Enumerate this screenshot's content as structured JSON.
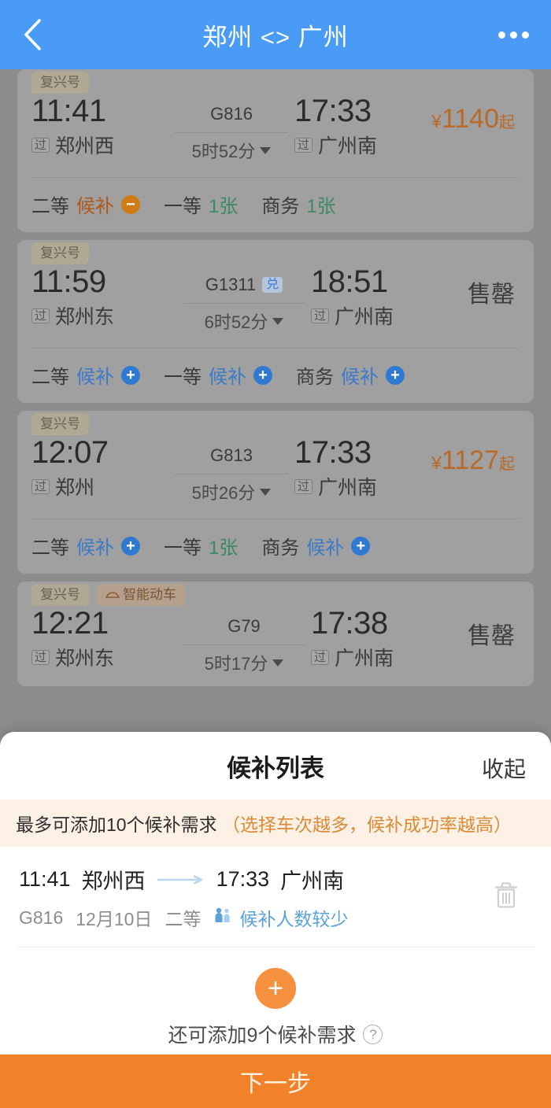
{
  "header": {
    "back_icon": "chevron-left-icon",
    "title": "郑州 <> 广州",
    "more_icon": "more-dots-icon",
    "bg_color": "#4a9bf5"
  },
  "trains": [
    {
      "badges": [
        "复兴号"
      ],
      "depart_time": "11:41",
      "depart_pass": "过",
      "depart_station": "郑州西",
      "train_no": "G816",
      "train_badge": "",
      "duration": "5时52分",
      "arrive_time": "17:33",
      "arrive_pass": "过",
      "arrive_station": "广州南",
      "price_prefix": "¥",
      "price": "1140",
      "price_suffix": "起",
      "sold_out": "",
      "seats": [
        {
          "label": "二等",
          "value": "候补",
          "state": "orange",
          "icon": "minus-circle-icon"
        },
        {
          "label": "一等",
          "value": "1张",
          "state": "green",
          "icon": ""
        },
        {
          "label": "商务",
          "value": "1张",
          "state": "green",
          "icon": ""
        }
      ]
    },
    {
      "badges": [
        "复兴号"
      ],
      "depart_time": "11:59",
      "depart_pass": "过",
      "depart_station": "郑州东",
      "train_no": "G1311",
      "train_badge": "兑",
      "duration": "6时52分",
      "arrive_time": "18:51",
      "arrive_pass": "过",
      "arrive_station": "广州南",
      "price_prefix": "",
      "price": "",
      "price_suffix": "",
      "sold_out": "售罄",
      "seats": [
        {
          "label": "二等",
          "value": "候补",
          "state": "blue",
          "icon": "plus-circle-icon"
        },
        {
          "label": "一等",
          "value": "候补",
          "state": "blue",
          "icon": "plus-circle-icon"
        },
        {
          "label": "商务",
          "value": "候补",
          "state": "blue",
          "icon": "plus-circle-icon"
        }
      ]
    },
    {
      "badges": [
        "复兴号"
      ],
      "depart_time": "12:07",
      "depart_pass": "过",
      "depart_station": "郑州",
      "train_no": "G813",
      "train_badge": "",
      "duration": "5时26分",
      "arrive_time": "17:33",
      "arrive_pass": "过",
      "arrive_station": "广州南",
      "price_prefix": "¥",
      "price": "1127",
      "price_suffix": "起",
      "sold_out": "",
      "seats": [
        {
          "label": "二等",
          "value": "候补",
          "state": "blue",
          "icon": "plus-circle-icon"
        },
        {
          "label": "一等",
          "value": "1张",
          "state": "green",
          "icon": ""
        },
        {
          "label": "商务",
          "value": "候补",
          "state": "blue",
          "icon": "plus-circle-icon"
        }
      ]
    },
    {
      "badges": [
        "复兴号",
        "智能动车"
      ],
      "depart_time": "12:21",
      "depart_pass": "过",
      "depart_station": "郑州东",
      "train_no": "G79",
      "train_badge": "",
      "duration": "5时17分",
      "arrive_time": "17:38",
      "arrive_pass": "过",
      "arrive_station": "广州南",
      "price_prefix": "",
      "price": "",
      "price_suffix": "",
      "sold_out": "售罄",
      "seats": []
    }
  ],
  "sheet": {
    "title": "候补列表",
    "collapse_label": "收起",
    "banner_main": "最多可添加10个候补需求",
    "banner_hint": "（选择车次越多，候补成功率越高）",
    "items": [
      {
        "depart_time": "11:41",
        "depart_station": "郑州西",
        "arrive_time": "17:33",
        "arrive_station": "广州南",
        "train_no": "G816",
        "date": "12月10日",
        "seat_class": "二等",
        "queue_note": "候补人数较少",
        "delete_icon": "trash-icon"
      }
    ],
    "add_icon": "plus-circle-icon",
    "add_label": "还可添加9个候补需求",
    "help_icon": "question-mark-icon",
    "next_label": "下一步",
    "next_color": "#f2822a"
  }
}
